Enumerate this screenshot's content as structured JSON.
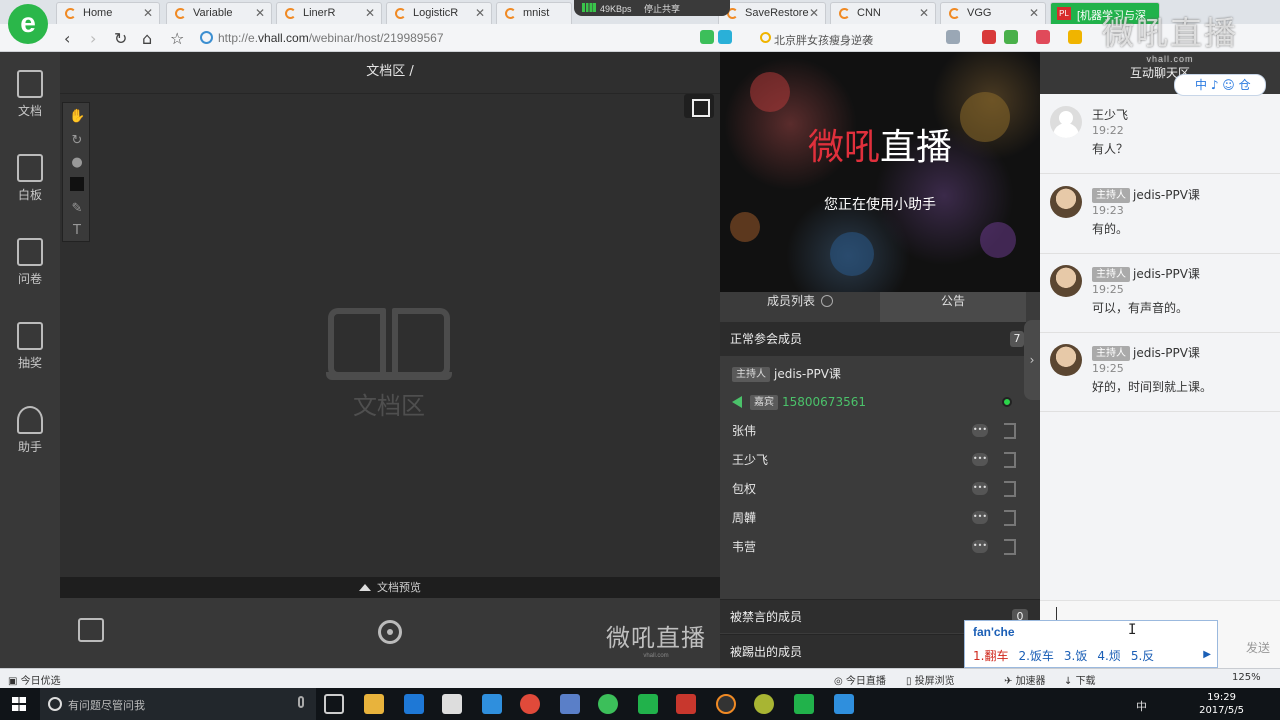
{
  "browser": {
    "tabs": [
      {
        "label": "Home"
      },
      {
        "label": "Variable"
      },
      {
        "label": "LinerR"
      },
      {
        "label": "LogisticR"
      },
      {
        "label": "mnist"
      },
      {
        "label": "SaveRestore"
      },
      {
        "label": "CNN"
      },
      {
        "label": "VGG"
      },
      {
        "label": "[机器学习与深"
      }
    ],
    "share_pill": {
      "speed": "49KBps",
      "stop_label": "停止共享"
    },
    "url_prefix": "http://e.",
    "url_domain": "vhall.com",
    "url_path": "/webinar/host/219989567",
    "search_text": "北京胖女孩瘦身逆袭"
  },
  "leftnav": {
    "items": [
      {
        "label": "文档"
      },
      {
        "label": "白板"
      },
      {
        "label": "问卷"
      },
      {
        "label": "抽奖"
      },
      {
        "label": "助手"
      }
    ]
  },
  "doc": {
    "title": "文档区 /",
    "placeholder": "文档区",
    "preview_label": "文档预览",
    "brand": "微吼直播",
    "brand_sub": "vhall.com"
  },
  "video": {
    "brand_red": "微吼",
    "brand_white": "直播",
    "note": "您正在使用小助手"
  },
  "members": {
    "tab_list": "成员列表",
    "tab_notice": "公告",
    "group_normal": "正常参会成员",
    "group_normal_count": "7",
    "host_badge": "主持人",
    "host_name": "jedis-PPV课",
    "guest_badge": "嘉宾",
    "guest_name": "15800673561",
    "people": [
      {
        "name": "张伟"
      },
      {
        "name": "王少飞"
      },
      {
        "name": "包权"
      },
      {
        "name": "周韡"
      },
      {
        "name": "韦营"
      }
    ],
    "muted_label": "被禁言的成员",
    "muted_count": "0",
    "kicked_label": "被踢出的成员"
  },
  "chat": {
    "title": "互动聊天区",
    "messages": [
      {
        "badge": "",
        "name": "王少飞",
        "time": "19:22",
        "text": "有人？"
      },
      {
        "badge": "主持人",
        "name": "jedis-PPV课",
        "time": "19:23",
        "text": "有的。"
      },
      {
        "badge": "主持人",
        "name": "jedis-PPV课",
        "time": "19:25",
        "text": "可以，有声音的。"
      },
      {
        "badge": "主持人",
        "name": "jedis-PPV课",
        "time": "19:25",
        "text": "好的，时间到就上课。"
      }
    ],
    "send_label": "发送"
  },
  "watermark": {
    "text": "微吼直播",
    "sub": "vhall.com"
  },
  "ime": {
    "indicator": "中 ♪ ☺ 仓",
    "composition": "fan'che",
    "candidates": [
      "1.翻车",
      "2.饭车",
      "3.饭",
      "4.烦",
      "5.反"
    ]
  },
  "statusbar": {
    "left": "今日优选",
    "today_live": "今日直播",
    "cast": "投屏浏览",
    "accelerator": "加速器",
    "download": "下载",
    "zoom": "125%"
  },
  "taskbar": {
    "search_placeholder": "有问题尽管问我",
    "ime_lang": "中",
    "time": "19:29",
    "date": "2017/5/5"
  },
  "colors": {
    "brand_green": "#21b24b",
    "brand_red": "#e0303c",
    "guest_green": "#4bc26a"
  }
}
